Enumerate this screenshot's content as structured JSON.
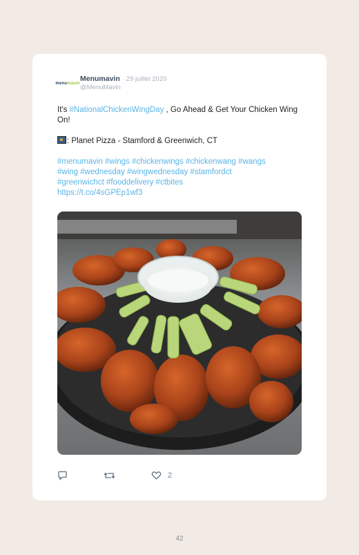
{
  "tweet": {
    "author_name": "Menumavin",
    "separator": "·",
    "date": "29 juillet 2020",
    "handle": "@MenuMavin",
    "avatar_logo": {
      "part1": "menu",
      "part2": "mavin"
    },
    "text_line1_prefix": "It's ",
    "text_line1_hashtag": "#NationalChickenWingDay",
    "text_line1_suffix": " , Go Ahead & Get Your Chicken Wing On!",
    "location_text": ": Planet Pizza - Stamford & Greenwich, CT",
    "hashtags_line1": "#menumavin #wings #chickenwings #chickenwang #wangs",
    "hashtags_line2": "#wing #wednesday #wingwednesday #stamfordct",
    "hashtags_line3": "#greenwichct #fooddelivery #ctbites",
    "short_link": "https://t.co/4sGPEp1wf3",
    "likes_count": "2"
  },
  "icons": {
    "reply": "reply-icon",
    "retweet": "retweet-icon",
    "like": "heart-icon",
    "location": "pin-icon"
  },
  "colors": {
    "link": "#5ab4e5",
    "page_background": "#f2ebe5",
    "card": "#ffffff"
  },
  "page": {
    "number": "42"
  }
}
